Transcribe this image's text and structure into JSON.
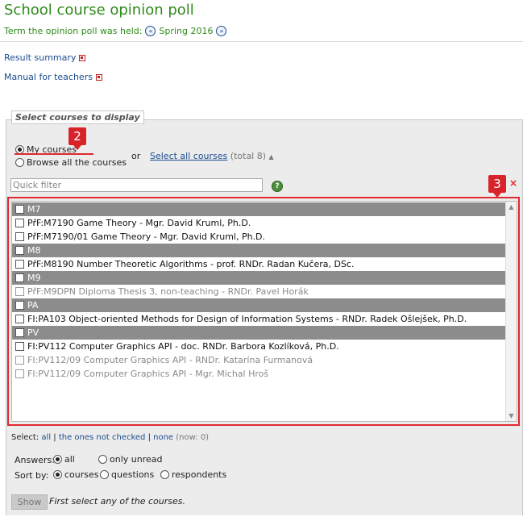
{
  "page": {
    "title": "School course opinion poll",
    "term_label": "Term the opinion poll was held:",
    "term_value": "Spring 2016"
  },
  "links": {
    "result_summary": "Result summary",
    "manual": "Manual for teachers"
  },
  "panel": {
    "legend": "Select courses to display",
    "my_courses": "My courses",
    "browse_all": "Browse all the courses",
    "or": "or",
    "select_all": "Select all courses",
    "select_all_total": "(total 8)",
    "filter_placeholder": "Quick filter",
    "help": "?",
    "clear": "×",
    "annotations": {
      "badge_2": "2",
      "badge_3": "3"
    }
  },
  "course_list": [
    {
      "kind": "group",
      "label": "M7"
    },
    {
      "kind": "course",
      "label": "PřF:M7190 Game Theory - Mgr. David Kruml, Ph.D.",
      "dim": false
    },
    {
      "kind": "course",
      "label": "PřF:M7190/01 Game Theory - Mgr. David Kruml, Ph.D.",
      "dim": false
    },
    {
      "kind": "group",
      "label": "M8"
    },
    {
      "kind": "course",
      "label": "PřF:M8190 Number Theoretic Algorithms - prof. RNDr. Radan Kučera, DSc.",
      "dim": false
    },
    {
      "kind": "group",
      "label": "M9"
    },
    {
      "kind": "course",
      "label": "PřF:M9DPN Diploma Thesis 3, non-teaching - RNDr. Pavel Horák",
      "dim": true
    },
    {
      "kind": "group",
      "label": "PA"
    },
    {
      "kind": "course",
      "label": "FI:PA103 Object-oriented Methods for Design of Information Systems - RNDr. Radek Ošlejšek, Ph.D.",
      "dim": false
    },
    {
      "kind": "group",
      "label": "PV"
    },
    {
      "kind": "course",
      "label": "FI:PV112 Computer Graphics API - doc. RNDr. Barbora Kozlíková, Ph.D.",
      "dim": false
    },
    {
      "kind": "course",
      "label": "FI:PV112/09 Computer Graphics API - RNDr. Katarína Furmanová",
      "dim": true
    },
    {
      "kind": "course",
      "label": "FI:PV112/09 Computer Graphics API - Mgr. Michal Hroš",
      "dim": true
    }
  ],
  "selection": {
    "label": "Select:",
    "all": "all",
    "not_checked": "the ones not checked",
    "none": "none",
    "now": "(now: 0)"
  },
  "options": {
    "answers_label": "Answers:",
    "answers_all": "all",
    "answers_unread": "only unread",
    "sort_label": "Sort by:",
    "sort_courses": "courses",
    "sort_questions": "questions",
    "sort_respondents": "respondents"
  },
  "actions": {
    "show": "Show",
    "note": "First select any of the courses."
  }
}
